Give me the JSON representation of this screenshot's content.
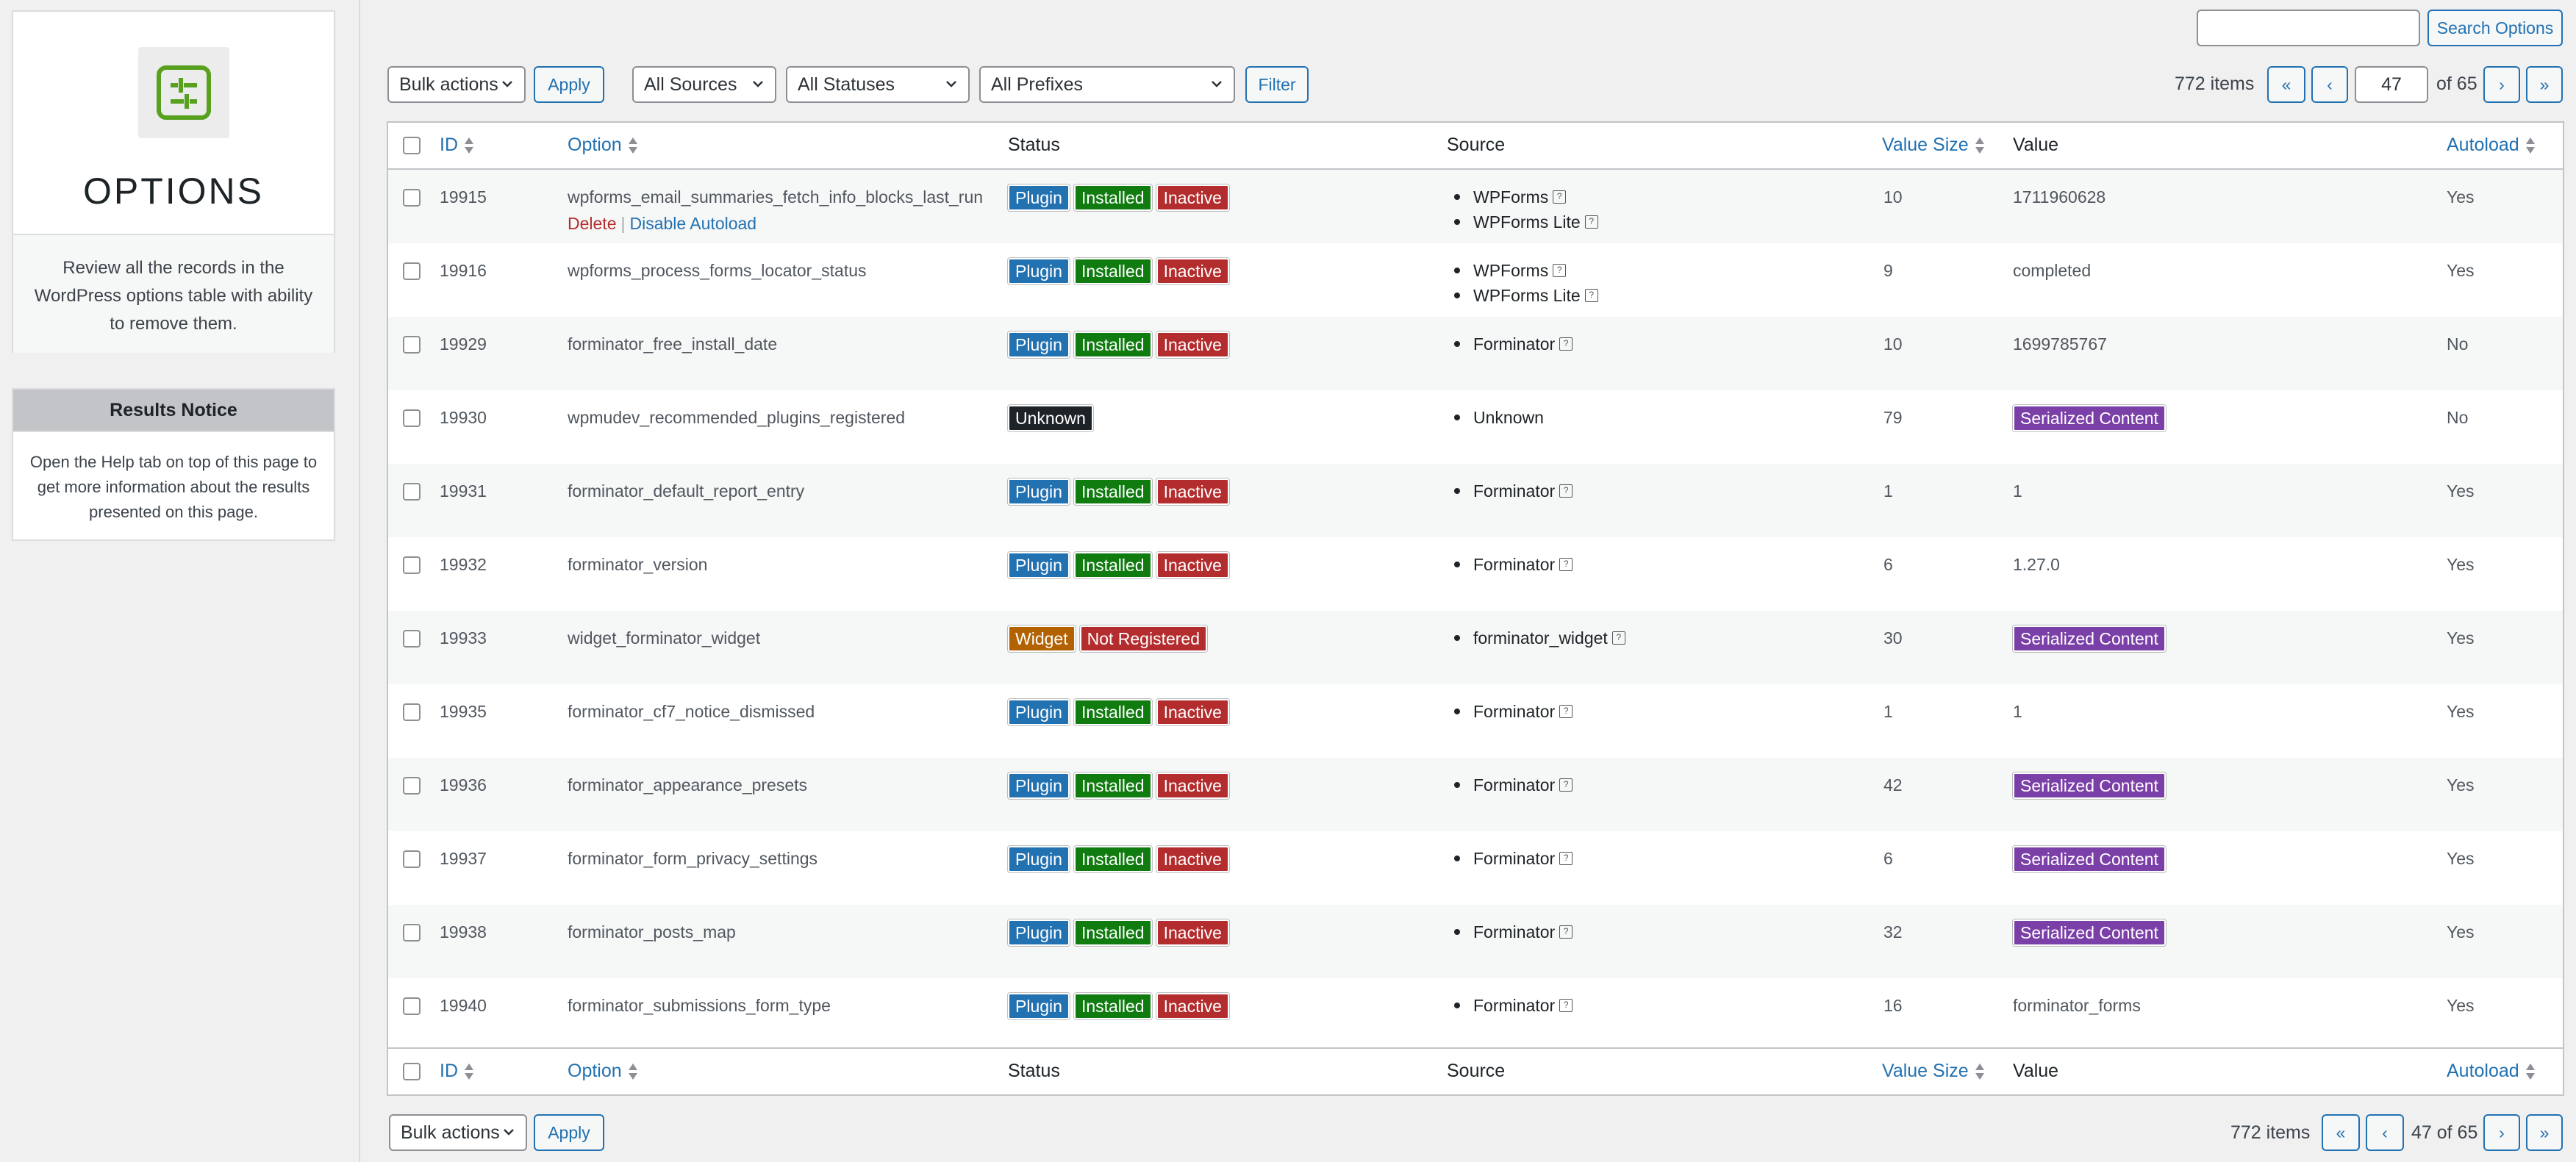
{
  "sidebar": {
    "logo_title": "OPTIONS",
    "description": "Review all the records in the WordPress options table with ability to remove them.",
    "notice_title": "Results Notice",
    "notice_body": "Open the Help tab on top of this page to get more information about the results presented on this page."
  },
  "search": {
    "value": "",
    "button_label": "Search Options"
  },
  "top_controls": {
    "bulk_actions": "Bulk actions",
    "apply": "Apply",
    "sources": "All Sources",
    "statuses": "All Statuses",
    "prefixes": "All Prefixes",
    "filter": "Filter"
  },
  "pagination_top": {
    "items": "772 items",
    "first": "«",
    "prev": "‹",
    "current_page": "47",
    "of_pages": "of 65",
    "next": "›",
    "last": "»"
  },
  "pagination_bottom": {
    "items": "772 items",
    "first": "«",
    "prev": "‹",
    "page_text": "47 of 65",
    "next": "›",
    "last": "»"
  },
  "columns": {
    "id": "ID",
    "option": "Option",
    "status": "Status",
    "source": "Source",
    "value_size": "Value Size",
    "value": "Value",
    "autoload": "Autoload"
  },
  "row_actions": {
    "delete": "Delete",
    "separator": "|",
    "disable_autoload": "Disable Autoload"
  },
  "badge_colors": {
    "Plugin": "#2271b1",
    "Installed": "#107c10",
    "Inactive": "#b32d2e",
    "Unknown": "#1d2327",
    "Widget": "#b26200",
    "Not Registered": "#b32d2e",
    "Serialized Content": "#7b3fa8"
  },
  "rows": [
    {
      "id": "19915",
      "option": "wpforms_email_summaries_fetch_info_blocks_last_run",
      "status": [
        "Plugin",
        "Installed",
        "Inactive"
      ],
      "sources": [
        {
          "name": "WPForms",
          "help": true
        },
        {
          "name": "WPForms Lite",
          "help": true
        }
      ],
      "size": "10",
      "value": "1711960628",
      "value_badge": false,
      "autoload": "Yes",
      "show_actions": true
    },
    {
      "id": "19916",
      "option": "wpforms_process_forms_locator_status",
      "status": [
        "Plugin",
        "Installed",
        "Inactive"
      ],
      "sources": [
        {
          "name": "WPForms",
          "help": true
        },
        {
          "name": "WPForms Lite",
          "help": true
        }
      ],
      "size": "9",
      "value": "completed",
      "value_badge": false,
      "autoload": "Yes"
    },
    {
      "id": "19929",
      "option": "forminator_free_install_date",
      "status": [
        "Plugin",
        "Installed",
        "Inactive"
      ],
      "sources": [
        {
          "name": "Forminator",
          "help": true
        }
      ],
      "size": "10",
      "value": "1699785767",
      "value_badge": false,
      "autoload": "No"
    },
    {
      "id": "19930",
      "option": "wpmudev_recommended_plugins_registered",
      "status": [
        "Unknown"
      ],
      "sources": [
        {
          "name": "Unknown",
          "help": false
        }
      ],
      "size": "79",
      "value": "Serialized Content",
      "value_badge": true,
      "autoload": "No"
    },
    {
      "id": "19931",
      "option": "forminator_default_report_entry",
      "status": [
        "Plugin",
        "Installed",
        "Inactive"
      ],
      "sources": [
        {
          "name": "Forminator",
          "help": true
        }
      ],
      "size": "1",
      "value": "1",
      "value_badge": false,
      "autoload": "Yes"
    },
    {
      "id": "19932",
      "option": "forminator_version",
      "status": [
        "Plugin",
        "Installed",
        "Inactive"
      ],
      "sources": [
        {
          "name": "Forminator",
          "help": true
        }
      ],
      "size": "6",
      "value": "1.27.0",
      "value_badge": false,
      "autoload": "Yes"
    },
    {
      "id": "19933",
      "option": "widget_forminator_widget",
      "status": [
        "Widget",
        "Not Registered"
      ],
      "sources": [
        {
          "name": "forminator_widget",
          "help": true
        }
      ],
      "size": "30",
      "value": "Serialized Content",
      "value_badge": true,
      "autoload": "Yes"
    },
    {
      "id": "19935",
      "option": "forminator_cf7_notice_dismissed",
      "status": [
        "Plugin",
        "Installed",
        "Inactive"
      ],
      "sources": [
        {
          "name": "Forminator",
          "help": true
        }
      ],
      "size": "1",
      "value": "1",
      "value_badge": false,
      "autoload": "Yes"
    },
    {
      "id": "19936",
      "option": "forminator_appearance_presets",
      "status": [
        "Plugin",
        "Installed",
        "Inactive"
      ],
      "sources": [
        {
          "name": "Forminator",
          "help": true
        }
      ],
      "size": "42",
      "value": "Serialized Content",
      "value_badge": true,
      "autoload": "Yes"
    },
    {
      "id": "19937",
      "option": "forminator_form_privacy_settings",
      "status": [
        "Plugin",
        "Installed",
        "Inactive"
      ],
      "sources": [
        {
          "name": "Forminator",
          "help": true
        }
      ],
      "size": "6",
      "value": "Serialized Content",
      "value_badge": true,
      "autoload": "Yes"
    },
    {
      "id": "19938",
      "option": "forminator_posts_map",
      "status": [
        "Plugin",
        "Installed",
        "Inactive"
      ],
      "sources": [
        {
          "name": "Forminator",
          "help": true
        }
      ],
      "size": "32",
      "value": "Serialized Content",
      "value_badge": true,
      "autoload": "Yes"
    },
    {
      "id": "19940",
      "option": "forminator_submissions_form_type",
      "status": [
        "Plugin",
        "Installed",
        "Inactive"
      ],
      "sources": [
        {
          "name": "Forminator",
          "help": true
        }
      ],
      "size": "16",
      "value": "forminator_forms",
      "value_badge": false,
      "autoload": "Yes"
    }
  ]
}
